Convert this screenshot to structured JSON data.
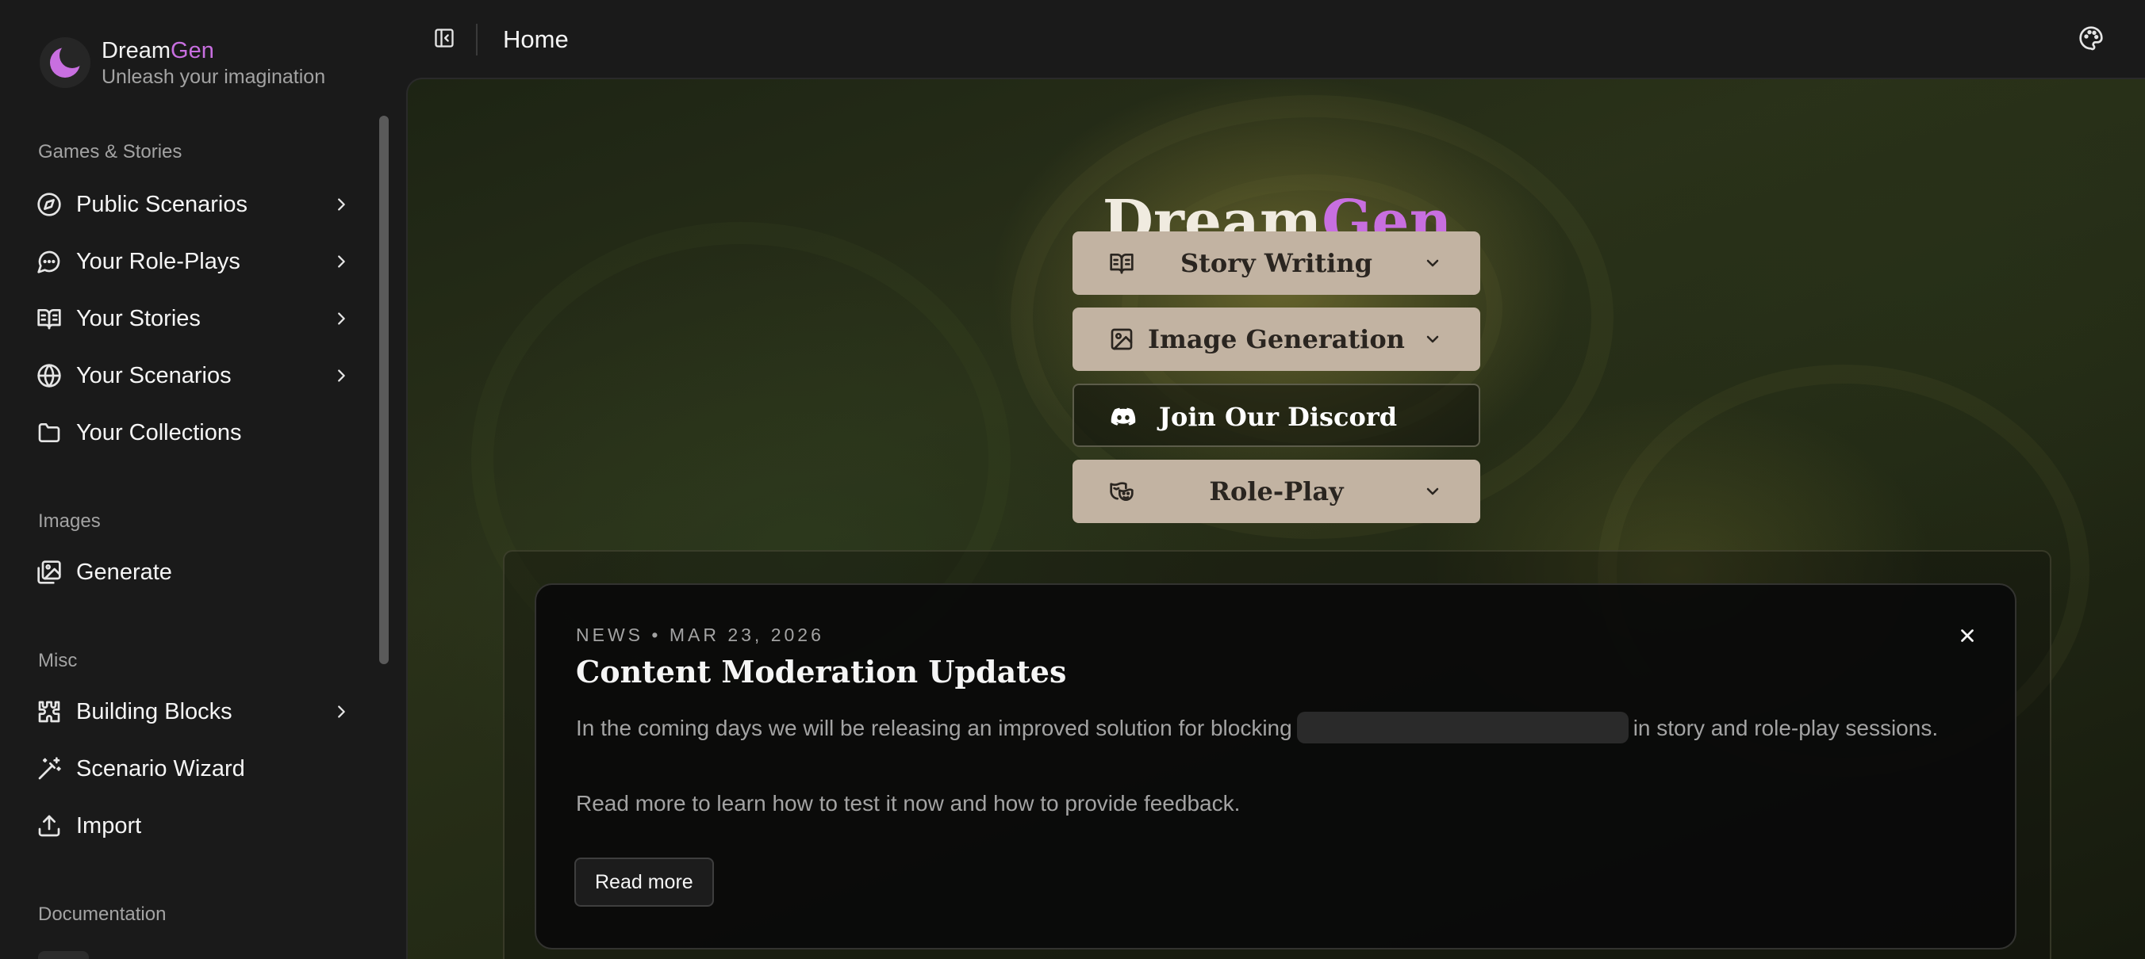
{
  "brand": {
    "name_prefix": "Dream",
    "name_suffix": "Gen",
    "tagline": "Unleash your imagination",
    "accent_color": "#c86fe0"
  },
  "sidebar": {
    "sections": [
      {
        "title": "Games & Stories",
        "items": [
          {
            "label": "Public Scenarios",
            "icon": "compass-icon",
            "has_chevron": true
          },
          {
            "label": "Your Role-Plays",
            "icon": "chat-bubble-icon",
            "has_chevron": true
          },
          {
            "label": "Your Stories",
            "icon": "open-book-icon",
            "has_chevron": true
          },
          {
            "label": "Your Scenarios",
            "icon": "globe-icon",
            "has_chevron": true
          },
          {
            "label": "Your Collections",
            "icon": "folder-icon",
            "has_chevron": false
          }
        ]
      },
      {
        "title": "Images",
        "items": [
          {
            "label": "Generate",
            "icon": "image-edit-icon",
            "has_chevron": false
          }
        ]
      },
      {
        "title": "Misc",
        "items": [
          {
            "label": "Building Blocks",
            "icon": "puzzle-icon",
            "has_chevron": true
          },
          {
            "label": "Scenario Wizard",
            "icon": "magic-wand-icon",
            "has_chevron": false
          },
          {
            "label": "Import",
            "icon": "upload-icon",
            "has_chevron": false
          }
        ]
      },
      {
        "title": "Documentation",
        "items": []
      }
    ]
  },
  "topbar": {
    "page_title": "Home"
  },
  "hero": {
    "title_prefix": "Dream",
    "title_suffix": "Gen",
    "buttons": [
      {
        "label": "Story Writing",
        "icon": "open-book-icon",
        "style": "filled",
        "has_chevron": true
      },
      {
        "label": "Image Generation",
        "icon": "image-icon",
        "style": "filled",
        "has_chevron": true
      },
      {
        "label": "Join Our Discord",
        "icon": "discord-icon",
        "style": "outline",
        "has_chevron": false
      },
      {
        "label": "Role-Play",
        "icon": "theater-masks-icon",
        "style": "filled",
        "has_chevron": true
      }
    ]
  },
  "news": {
    "meta": "NEWS • MAR 23, 2026",
    "title": "Content Moderation Updates",
    "body_before": "In the coming days we will be releasing an improved solution for blocking",
    "body_after": "in story and role-play sessions.",
    "body2": "Read more to learn how to test it now and how to provide feedback.",
    "read_more_label": "Read more"
  }
}
